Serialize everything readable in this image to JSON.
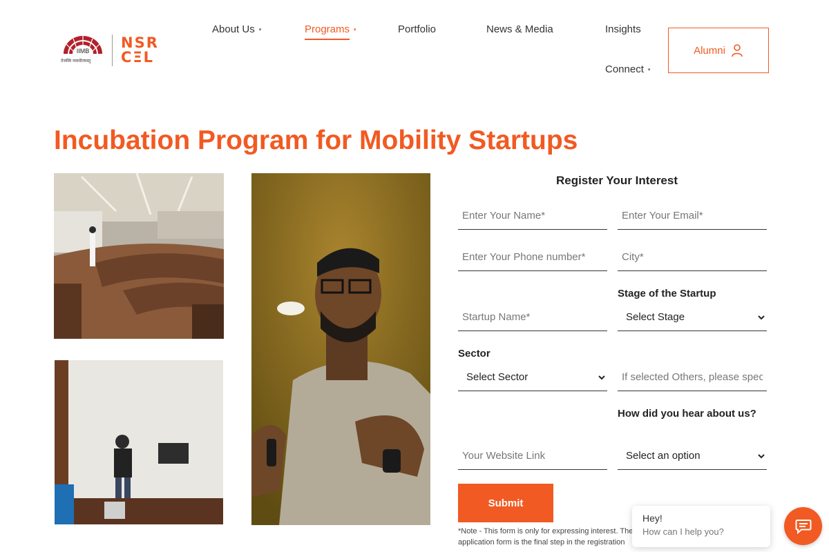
{
  "header": {
    "logo": {
      "iimb_text": "IIMB",
      "iimb_tagline": "तेजस्वि नावधीतमस्तु",
      "nsrcel_line1": "NSR",
      "nsrcel_line2": "CΞL"
    },
    "nav": [
      {
        "label": "About Us",
        "has_dropdown": true,
        "active": false
      },
      {
        "label": "Programs",
        "has_dropdown": true,
        "active": true
      },
      {
        "label": "Portfolio",
        "has_dropdown": false,
        "active": false
      },
      {
        "label": "News & Media",
        "has_dropdown": false,
        "active": false
      },
      {
        "label": "Insights",
        "has_dropdown": false,
        "active": false
      },
      {
        "label": "Connect",
        "has_dropdown": true,
        "active": false
      }
    ],
    "alumni_label": "Alumni",
    "caret": "▾"
  },
  "page_title": "Incubation Program for Mobility Startups",
  "form": {
    "title": "Register Your Interest",
    "name_placeholder": "Enter Your Name*",
    "email_placeholder": "Enter Your Email*",
    "phone_placeholder": "Enter Your Phone number*",
    "city_placeholder": "City*",
    "startup_placeholder": "Startup Name*",
    "stage_label": "Stage of the Startup",
    "stage_selected": "Select Stage",
    "sector_label": "Sector",
    "sector_selected": "Select Sector",
    "others_placeholder": "If selected Others, please specify",
    "hear_label": "How did you hear about us?",
    "hear_selected": "Select an option",
    "website_placeholder": "Your Website Link",
    "submit_label": "Submit",
    "note": "*Note - This form is only for expressing interest. The application form is the final step in the registration process."
  },
  "chat": {
    "greeting": "Hey!",
    "prompt": "How can I help you?",
    "icon": "chat-icon"
  },
  "colors": {
    "accent": "#f15a22",
    "logo_red": "#b3202a"
  }
}
